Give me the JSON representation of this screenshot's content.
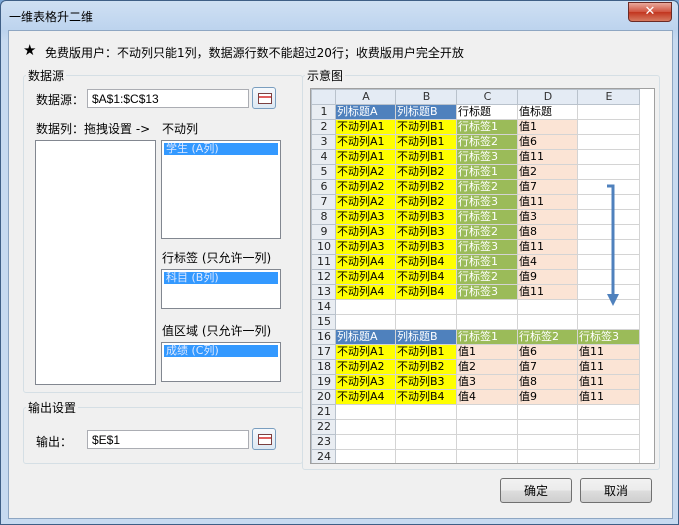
{
  "window": {
    "title": "一维表格升二维",
    "close_label": "✕"
  },
  "notice": "免费版用户：不动列只能1列，数据源行数不能超过20行；收费版用户完全开放",
  "data_source": {
    "group_label": "数据源",
    "source_label": "数据源：",
    "source_value": "$A$1:$C$13",
    "columns_label": "数据列：拖拽设置 ->",
    "fixed_label": "不动列",
    "fixed_items": [
      "学生 (A列)"
    ],
    "row_label": "行标签 (只允许一列)",
    "row_items": [
      "科目 (B列)"
    ],
    "value_label": "值区域 (只允许一列)",
    "value_items": [
      "成绩 (C列)"
    ]
  },
  "output": {
    "group_label": "输出设置",
    "label": "输出：",
    "value": "$E$1"
  },
  "preview": {
    "group_label": "示意图",
    "columns": [
      "A",
      "B",
      "C",
      "D",
      "E"
    ],
    "rows": [
      {
        "n": "1",
        "cells": [
          "列标题A",
          "列标题B",
          "行标题",
          "值标题",
          ""
        ],
        "styles": [
          "hb",
          "hb",
          "",
          "",
          ""
        ]
      },
      {
        "n": "2",
        "cells": [
          "不动列A1",
          "不动列B1",
          "行标签1",
          "值1",
          ""
        ],
        "styles": [
          "y",
          "y",
          "gn",
          "pk",
          ""
        ]
      },
      {
        "n": "3",
        "cells": [
          "不动列A1",
          "不动列B1",
          "行标签2",
          "值6",
          ""
        ],
        "styles": [
          "y",
          "y",
          "gn",
          "pk",
          ""
        ]
      },
      {
        "n": "4",
        "cells": [
          "不动列A1",
          "不动列B1",
          "行标签3",
          "值11",
          ""
        ],
        "styles": [
          "y",
          "y",
          "gn",
          "pk",
          ""
        ]
      },
      {
        "n": "5",
        "cells": [
          "不动列A2",
          "不动列B2",
          "行标签1",
          "值2",
          ""
        ],
        "styles": [
          "y",
          "y",
          "gn",
          "pk",
          ""
        ]
      },
      {
        "n": "6",
        "cells": [
          "不动列A2",
          "不动列B2",
          "行标签2",
          "值7",
          ""
        ],
        "styles": [
          "y",
          "y",
          "gn",
          "pk",
          ""
        ]
      },
      {
        "n": "7",
        "cells": [
          "不动列A2",
          "不动列B2",
          "行标签3",
          "值11",
          ""
        ],
        "styles": [
          "y",
          "y",
          "gn",
          "pk",
          ""
        ]
      },
      {
        "n": "8",
        "cells": [
          "不动列A3",
          "不动列B3",
          "行标签1",
          "值3",
          ""
        ],
        "styles": [
          "y",
          "y",
          "gn",
          "pk",
          ""
        ]
      },
      {
        "n": "9",
        "cells": [
          "不动列A3",
          "不动列B3",
          "行标签2",
          "值8",
          ""
        ],
        "styles": [
          "y",
          "y",
          "gn",
          "pk",
          ""
        ]
      },
      {
        "n": "10",
        "cells": [
          "不动列A3",
          "不动列B3",
          "行标签3",
          "值11",
          ""
        ],
        "styles": [
          "y",
          "y",
          "gn",
          "pk",
          ""
        ]
      },
      {
        "n": "11",
        "cells": [
          "不动列A4",
          "不动列B4",
          "行标签1",
          "值4",
          ""
        ],
        "styles": [
          "y",
          "y",
          "gn",
          "pk",
          ""
        ]
      },
      {
        "n": "12",
        "cells": [
          "不动列A4",
          "不动列B4",
          "行标签2",
          "值9",
          ""
        ],
        "styles": [
          "y",
          "y",
          "gn",
          "pk",
          ""
        ]
      },
      {
        "n": "13",
        "cells": [
          "不动列A4",
          "不动列B4",
          "行标签3",
          "值11",
          ""
        ],
        "styles": [
          "y",
          "y",
          "gn",
          "pk",
          ""
        ]
      },
      {
        "n": "14",
        "cells": [
          "",
          "",
          "",
          "",
          ""
        ],
        "styles": [
          "",
          "",
          "",
          "",
          ""
        ]
      },
      {
        "n": "15",
        "cells": [
          "",
          "",
          "",
          "",
          ""
        ],
        "styles": [
          "",
          "",
          "",
          "",
          ""
        ]
      },
      {
        "n": "16",
        "cells": [
          "列标题A",
          "列标题B",
          "行标签1",
          "行标签2",
          "行标签3"
        ],
        "styles": [
          "hb",
          "hb",
          "gn",
          "gn",
          "gn"
        ]
      },
      {
        "n": "17",
        "cells": [
          "不动列A1",
          "不动列B1",
          "值1",
          "值6",
          "值11"
        ],
        "styles": [
          "y",
          "y",
          "pk",
          "pk",
          "pk"
        ]
      },
      {
        "n": "18",
        "cells": [
          "不动列A2",
          "不动列B2",
          "值2",
          "值7",
          "值11"
        ],
        "styles": [
          "y",
          "y",
          "pk",
          "pk",
          "pk"
        ]
      },
      {
        "n": "19",
        "cells": [
          "不动列A3",
          "不动列B3",
          "值3",
          "值8",
          "值11"
        ],
        "styles": [
          "y",
          "y",
          "pk",
          "pk",
          "pk"
        ]
      },
      {
        "n": "20",
        "cells": [
          "不动列A4",
          "不动列B4",
          "值4",
          "值9",
          "值11"
        ],
        "styles": [
          "y",
          "y",
          "pk",
          "pk",
          "pk"
        ]
      },
      {
        "n": "21",
        "cells": [
          "",
          "",
          "",
          "",
          ""
        ],
        "styles": [
          "",
          "",
          "",
          "",
          ""
        ]
      },
      {
        "n": "22",
        "cells": [
          "",
          "",
          "",
          "",
          ""
        ],
        "styles": [
          "",
          "",
          "",
          "",
          ""
        ]
      },
      {
        "n": "23",
        "cells": [
          "",
          "",
          "",
          "",
          ""
        ],
        "styles": [
          "",
          "",
          "",
          "",
          ""
        ]
      },
      {
        "n": "24",
        "cells": [
          "",
          "",
          "",
          "",
          ""
        ],
        "styles": [
          "",
          "",
          "",
          "",
          ""
        ]
      }
    ],
    "arrow_color": "#4f81bd"
  },
  "buttons": {
    "ok": "确定",
    "cancel": "取消"
  },
  "icons": {
    "notice": "star-icon",
    "picker": "range-picker-icon"
  }
}
